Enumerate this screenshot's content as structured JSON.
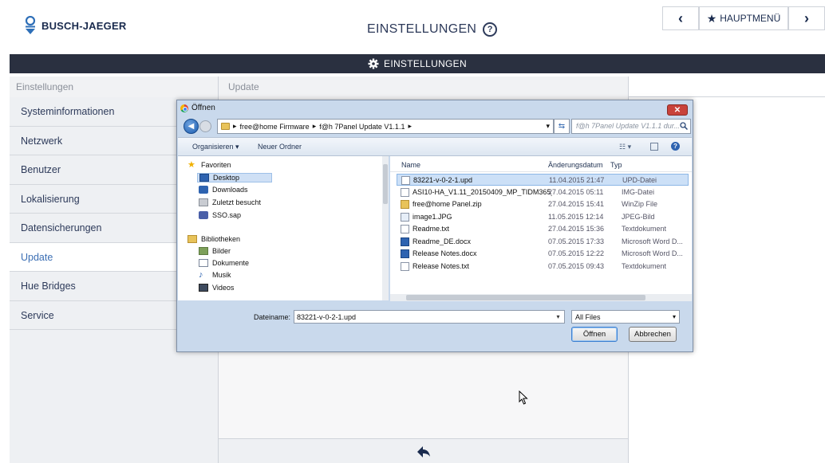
{
  "header": {
    "brand": "BUSCH-JAEGER",
    "title": "EINSTELLUNGEN",
    "help": "?",
    "back": "‹",
    "main_menu": "HAUPTMENÜ",
    "forward": "›"
  },
  "bar": {
    "title": "EINSTELLUNGEN"
  },
  "breadcrumb": {
    "left": "Einstellungen",
    "middle": "Update"
  },
  "sidebar": {
    "items": [
      {
        "label": "Systeminformationen"
      },
      {
        "label": "Netzwerk"
      },
      {
        "label": "Benutzer"
      },
      {
        "label": "Lokalisierung"
      },
      {
        "label": "Datensicherungen"
      },
      {
        "label": "Update",
        "active": true
      },
      {
        "label": "Hue Bridges"
      },
      {
        "label": "Service"
      }
    ]
  },
  "dialog": {
    "title": "Öffnen",
    "close": "✕",
    "path": [
      "free@home Firmware",
      "f@h 7Panel Update V1.1.1"
    ],
    "search_placeholder": "f@h 7Panel Update V1.1.1 dur...",
    "toolbar": {
      "organize": "Organisieren ▾",
      "new_folder": "Neuer Ordner"
    },
    "nav": {
      "favorites": "Favoriten",
      "desktop": "Desktop",
      "downloads": "Downloads",
      "recent": "Zuletzt besucht",
      "sso": "SSO.sap",
      "libraries": "Bibliotheken",
      "pictures": "Bilder",
      "documents": "Dokumente",
      "music": "Musik",
      "videos": "Videos"
    },
    "columns": {
      "name": "Name",
      "date": "Änderungsdatum",
      "type": "Typ"
    },
    "files": [
      {
        "name": "83221-v-0-2-1.upd",
        "date": "11.04.2015 21:47",
        "type": "UPD-Datei",
        "icon": "doc",
        "selected": true
      },
      {
        "name": "ASI10-HA_V1.11_20150409_MP_TIDM365_...",
        "date": "27.04.2015 05:11",
        "type": "IMG-Datei",
        "icon": "doc"
      },
      {
        "name": "free@home Panel.zip",
        "date": "27.04.2015 15:41",
        "type": "WinZip File",
        "icon": "zip"
      },
      {
        "name": "image1.JPG",
        "date": "11.05.2015 12:14",
        "type": "JPEG-Bild",
        "icon": "jpg"
      },
      {
        "name": "Readme.txt",
        "date": "27.04.2015 15:36",
        "type": "Textdokument",
        "icon": "doc"
      },
      {
        "name": "Readme_DE.docx",
        "date": "07.05.2015 17:33",
        "type": "Microsoft Word D...",
        "icon": "word"
      },
      {
        "name": "Release Notes.docx",
        "date": "07.05.2015 12:22",
        "type": "Microsoft Word D...",
        "icon": "word"
      },
      {
        "name": "Release Notes.txt",
        "date": "07.05.2015 09:43",
        "type": "Textdokument",
        "icon": "doc"
      }
    ],
    "filename_label": "Dateiname:",
    "filename_value": "83221-v-0-2-1.upd",
    "filetype": "All Files",
    "open_label": "Öffnen",
    "cancel_label": "Abbrechen"
  }
}
